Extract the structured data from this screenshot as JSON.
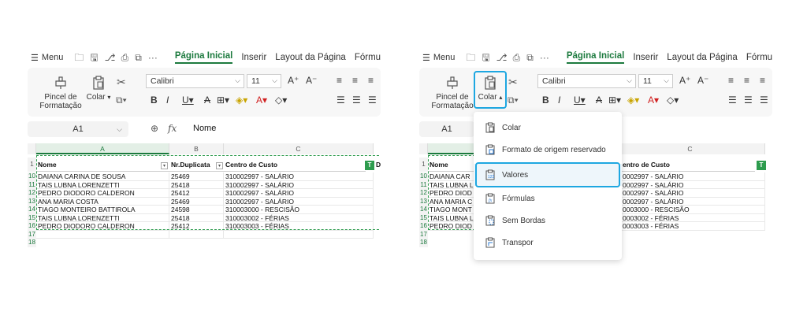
{
  "menu": {
    "label": "Menu",
    "tabs": [
      "Página Inicial",
      "Inserir",
      "Layout da Página",
      "Fórmul"
    ],
    "tabs_right": [
      "Página Inicial",
      "Inserir",
      "Layout da Página",
      "Fórmu"
    ],
    "more": "···"
  },
  "ribbon": {
    "pincel_label_1": "Pincel de",
    "pincel_label_2": "Formatação",
    "colar_label": "Colar",
    "font_name": "Calibri",
    "font_size": "11",
    "grow": "A⁺",
    "shrink": "A⁻"
  },
  "formula_bar": {
    "cell_ref": "A1",
    "fx": "fx",
    "value": "Nome"
  },
  "sheet": {
    "columns": [
      "A",
      "B",
      "C"
    ],
    "header_row_num": "1",
    "headers": [
      "Nome",
      "Nr.Duplicata",
      "Centro de Custo",
      "D"
    ],
    "rows": [
      {
        "num": "10",
        "nome": "DAIANA CARINA DE SOUSA",
        "dup": "25469",
        "cc": "310002997 - SALÁRIO"
      },
      {
        "num": "11",
        "nome": "TAIS LUBNA LORENZETTI",
        "dup": "25418",
        "cc": "310002997 - SALÁRIO"
      },
      {
        "num": "12",
        "nome": "PEDRO DIODORO CALDERON",
        "dup": "25412",
        "cc": "310002997 - SALÁRIO"
      },
      {
        "num": "13",
        "nome": "ANA MARIA COSTA",
        "dup": "25469",
        "cc": "310002997 - SALÁRIO"
      },
      {
        "num": "14",
        "nome": "TIAGO MONTEIRO BATTIROLA",
        "dup": "24598",
        "cc": "310003000 - RESCISÃO"
      },
      {
        "num": "15",
        "nome": "TAIS LUBNA LORENZETTI",
        "dup": "25418",
        "cc": "310003002 - FÉRIAS"
      },
      {
        "num": "16",
        "nome": "PEDRO DIODORO CALDERON",
        "dup": "25412",
        "cc": "310003003 - FÉRIAS"
      }
    ],
    "extra_rows": [
      "17",
      "18"
    ],
    "right_rows": [
      {
        "nome": "DAIANA CAR",
        "cc": "0002997 - SALÁRIO"
      },
      {
        "nome": "TAIS LUBNA L",
        "cc": "0002997 - SALÁRIO"
      },
      {
        "nome": "PEDRO DIOD",
        "cc": "0002997 - SALÁRIO"
      },
      {
        "nome": "ANA MARIA C",
        "cc": "0002997 - SALÁRIO"
      },
      {
        "nome": "TIAGO MONT",
        "cc": "0003000 - RESCISÃO"
      },
      {
        "nome": "TAIS LUBNA L",
        "cc": "0003002 - FÉRIAS"
      },
      {
        "nome": "PEDRO DIOD",
        "cc": "0003003 - FÉRIAS"
      }
    ],
    "right_header_cc": "entro de Custo",
    "tag": "T"
  },
  "paste_menu": {
    "items": [
      "Colar",
      "Formato de origem reservado",
      "Valores",
      "Fórmulas",
      "Sem Bordas",
      "Transpor"
    ],
    "highlighted": "Valores"
  },
  "colors": {
    "accent_green": "#1c7a3e",
    "highlight_blue": "#1ea7e1",
    "copy_dash": "#2e9c4e"
  }
}
